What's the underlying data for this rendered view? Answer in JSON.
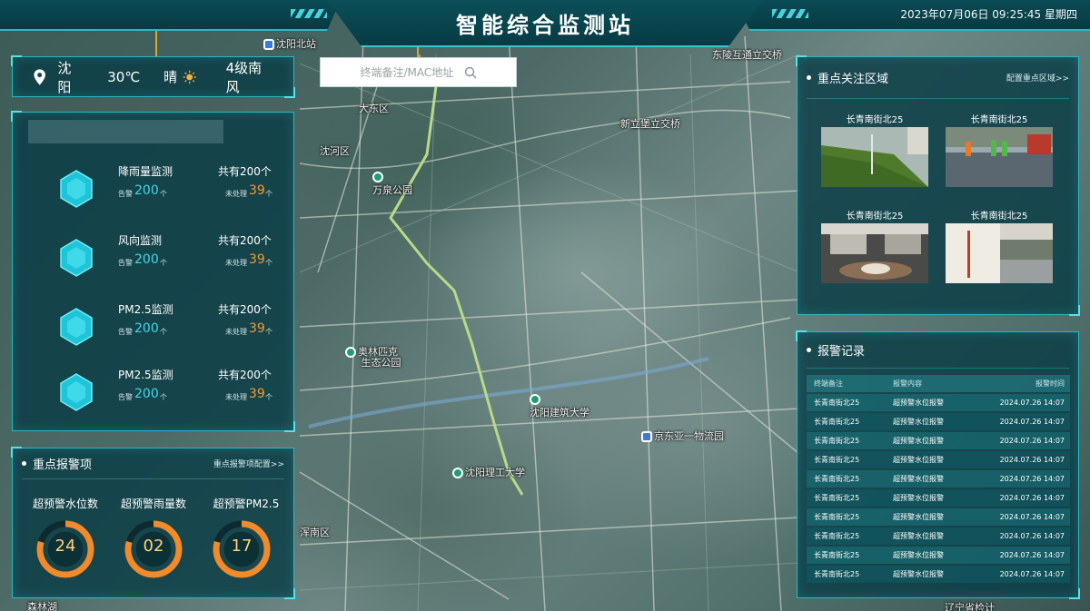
{
  "header": {
    "title": "智能综合监测站",
    "datetime": "2023年07月06日  09:25:45  星期四"
  },
  "search": {
    "placeholder": "终端备注/MAC地址"
  },
  "weather": {
    "city": "沈阳",
    "temperature": "30℃",
    "condition": "晴",
    "wind": "4级南风"
  },
  "monitors": [
    {
      "name": "降雨量监测",
      "total": "共有200个",
      "alarm_label": "告警",
      "alarm_value": "200",
      "alarm_unit": "个",
      "pending_label": "未处理",
      "pending_value": "39",
      "pending_unit": "个"
    },
    {
      "name": "风向监测",
      "total": "共有200个",
      "alarm_label": "告警",
      "alarm_value": "200",
      "alarm_unit": "个",
      "pending_label": "未处理",
      "pending_value": "39",
      "pending_unit": "个"
    },
    {
      "name": "PM2.5监测",
      "total": "共有200个",
      "alarm_label": "告警",
      "alarm_value": "200",
      "alarm_unit": "个",
      "pending_label": "未处理",
      "pending_value": "39",
      "pending_unit": "个"
    },
    {
      "name": "PM2.5监测",
      "total": "共有200个",
      "alarm_label": "告警",
      "alarm_value": "200",
      "alarm_unit": "个",
      "pending_label": "未处理",
      "pending_value": "39",
      "pending_unit": "个"
    }
  ],
  "key_alarms": {
    "title": "重点报警项",
    "link": "重点报警项配置>>",
    "items": [
      {
        "label": "超预警水位数",
        "value": "24"
      },
      {
        "label": "超预警雨量数",
        "value": "02"
      },
      {
        "label": "超预警PM2.5",
        "value": "17"
      }
    ]
  },
  "focus_areas": {
    "title": "重点关注区域",
    "link": "配置重点区域>>",
    "cameras": [
      {
        "label": "长青南街北25"
      },
      {
        "label": "长青南街北25"
      },
      {
        "label": "长青南街北25"
      },
      {
        "label": "长青南街北25"
      }
    ]
  },
  "alarm_records": {
    "title": "报警记录",
    "columns": [
      "终端备注",
      "报警内容",
      "报警时间"
    ],
    "rows": [
      [
        "长青南街北25",
        "超预警水位报警",
        "2024.07.26 14:07"
      ],
      [
        "长青南街北25",
        "超预警水位报警",
        "2024.07.26 14:07"
      ],
      [
        "长青南街北25",
        "超预警水位报警",
        "2024.07.26 14:07"
      ],
      [
        "长青南街北25",
        "超预警水位报警",
        "2024.07.26 14:07"
      ],
      [
        "长青南街北25",
        "超预警水位报警",
        "2024.07.26 14:07"
      ],
      [
        "长青南街北25",
        "超预警水位报警",
        "2024.07.26 14:07"
      ],
      [
        "长青南街北25",
        "超预警水位报警",
        "2024.07.26 14:07"
      ],
      [
        "长青南街北25",
        "超预警水位报警",
        "2024.07.26 14:07"
      ],
      [
        "长青南街北25",
        "超预警水位报警",
        "2024.07.26 14:07"
      ],
      [
        "长青南街北25",
        "超预警水位报警",
        "2024.07.26 14:07"
      ]
    ]
  },
  "map_labels": {
    "wanquan_park": "万泉公园",
    "dadong": "大东区",
    "shenhe": "沈河区",
    "olympic": "奥林匹克\n生态公园",
    "jianzhu_univ": "沈阳建筑大学",
    "ligong_univ": "沈阳理工大学",
    "jingdong": "京东亚一物流园",
    "xinli": "新立堡立交桥",
    "dongling": "东陵互通立交桥",
    "shenyang_north": "沈阳北站",
    "senlin": "森林湖",
    "liaoning": "辽宁省检计",
    "hunnan": "浑南区"
  }
}
